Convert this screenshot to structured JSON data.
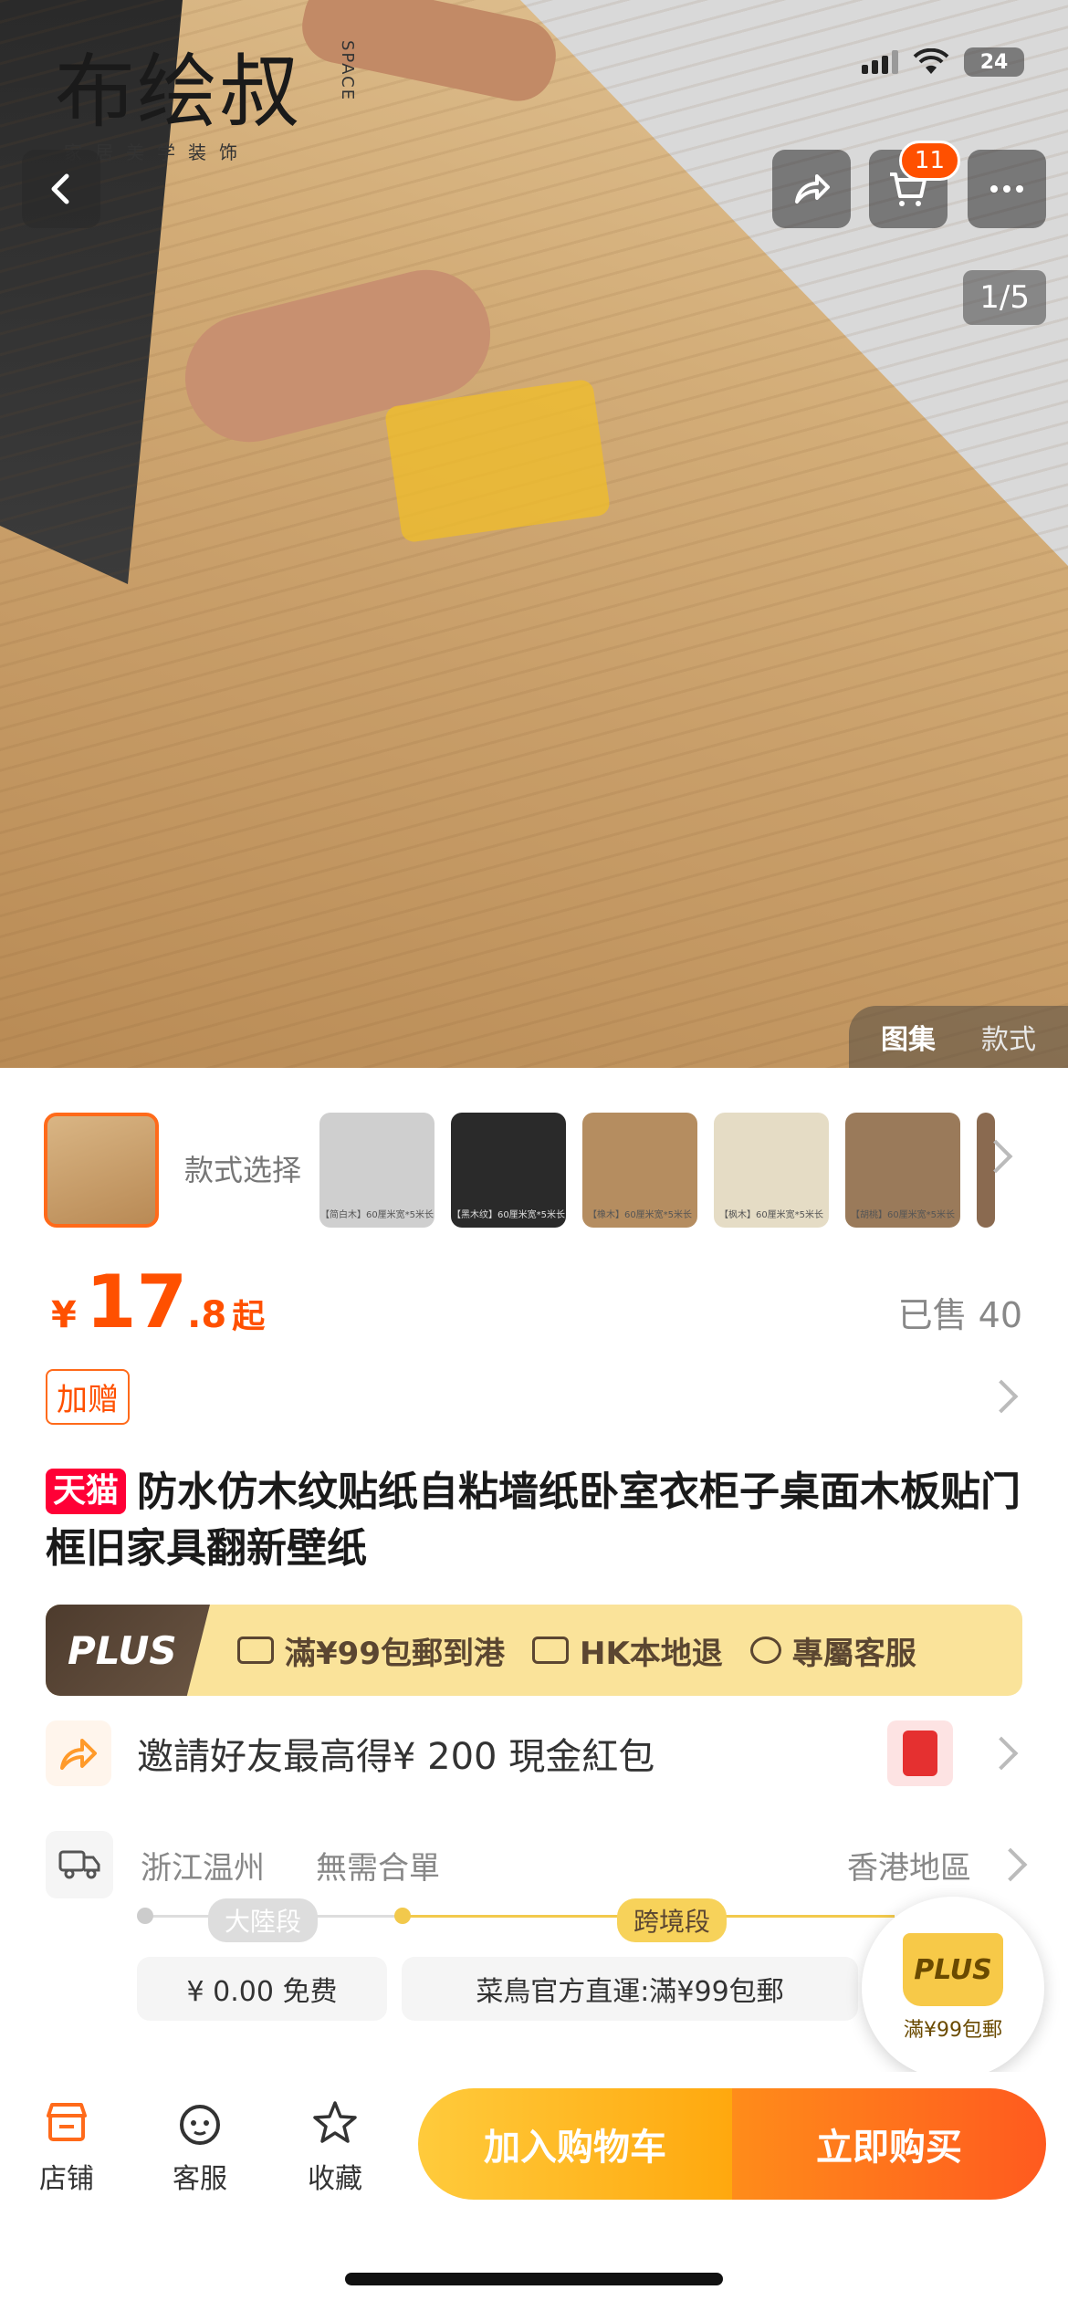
{
  "logo": {
    "main": "布绘叔",
    "sub": "家居美学装饰",
    "vert": "SPACE"
  },
  "status_bar": {
    "battery": "24"
  },
  "cart_badge": "11",
  "image_counter": "1/5",
  "hero_tabs": [
    "图集",
    "款式"
  ],
  "style_select_label": "款式选择",
  "thumbnails": [
    {
      "caption": "【简白木】60厘米宽*5米长",
      "color": "#cfcfcf"
    },
    {
      "caption": "【黑木纹】60厘米宽*5米长",
      "color": "#2a2a2a"
    },
    {
      "caption": "【橡木】60厘米宽*5米长",
      "color": "#b58d60"
    },
    {
      "caption": "【枫木】60厘米宽*5米长",
      "color": "#e5dcc5"
    },
    {
      "caption": "【胡桃】60厘米宽*5米长",
      "color": "#9a7a5a"
    }
  ],
  "price": {
    "currency": "¥",
    "integer": "17",
    "decimal": ".8",
    "suffix": "起",
    "sold": "已售 40"
  },
  "gift_tag": "加赠",
  "title": {
    "badge": "天猫",
    "text": "防水仿木纹贴纸自粘墙纸卧室衣柜子桌面木板贴门框旧家具翻新壁纸"
  },
  "plus_bar": {
    "logo": "PLUS",
    "items": [
      "滿¥99包郵到港",
      "HK本地退",
      "專屬客服"
    ]
  },
  "invite": {
    "text": "邀請好友最高得¥ 200 現金紅包"
  },
  "shipping": {
    "from": "浙江温州",
    "note": "無需合單",
    "to": "香港地區",
    "segment1": "大陸段",
    "segment2": "跨境段",
    "fee1": "¥ 0.00 免费",
    "fee2": "菜鳥官方直運:滿¥99包郵"
  },
  "plus_float": {
    "label": "PLUS",
    "caption": "滿¥99包郵"
  },
  "bottom_bar": {
    "shop": "店铺",
    "service": "客服",
    "favorite": "收藏",
    "add_to_cart": "加入购物车",
    "buy_now": "立即购买"
  },
  "colors": {
    "accent": "#ff5000",
    "tmall": "#ff0036",
    "plus_gold": "#fae39a"
  }
}
